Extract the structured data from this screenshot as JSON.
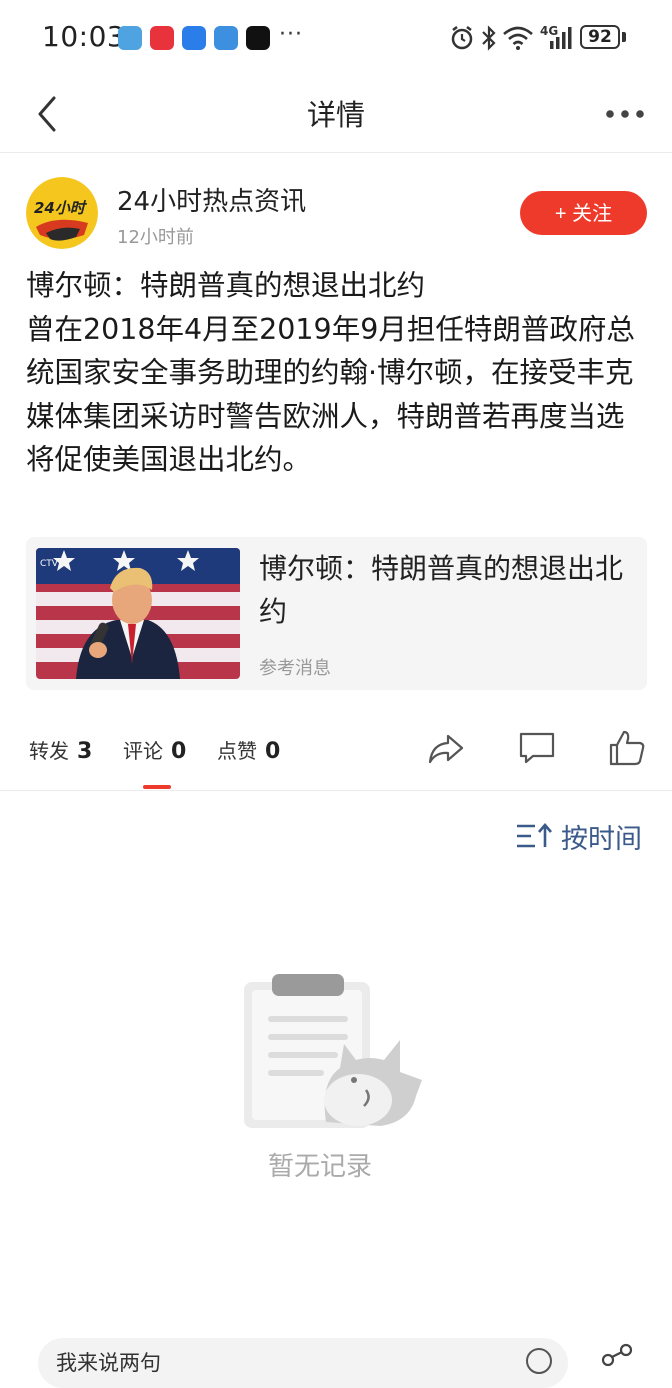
{
  "status_bar": {
    "time": "10:03",
    "network": "4G",
    "battery": "92",
    "more": "···"
  },
  "nav": {
    "title": "详情"
  },
  "post": {
    "author": "24小时热点资讯",
    "avatar_text": "24小时",
    "time_ago": "12小时前",
    "follow_label": "+ 关注",
    "title_line": "博尔顿：特朗普真的想退出北约",
    "body": "曾在2018年4月至2019年9月担任特朗普政府总统国家安全事务助理的约翰·博尔顿，在接受丰克媒体集团采访时警告欧洲人，特朗普若再度当选将促使美国退出北约。"
  },
  "card": {
    "title": "博尔顿：特朗普真的想退出北约",
    "source": "参考消息"
  },
  "stats": {
    "repost_label": "转发",
    "repost_count": "3",
    "comment_label": "评论",
    "comment_count": "0",
    "like_label": "点赞",
    "like_count": "0"
  },
  "sort": {
    "label": "按时间"
  },
  "empty": {
    "text": "暂无记录"
  },
  "comment_bar": {
    "placeholder": "我来说两句"
  },
  "colors": {
    "accent": "#ee3a2b",
    "sort_blue": "#3a5a8a"
  }
}
